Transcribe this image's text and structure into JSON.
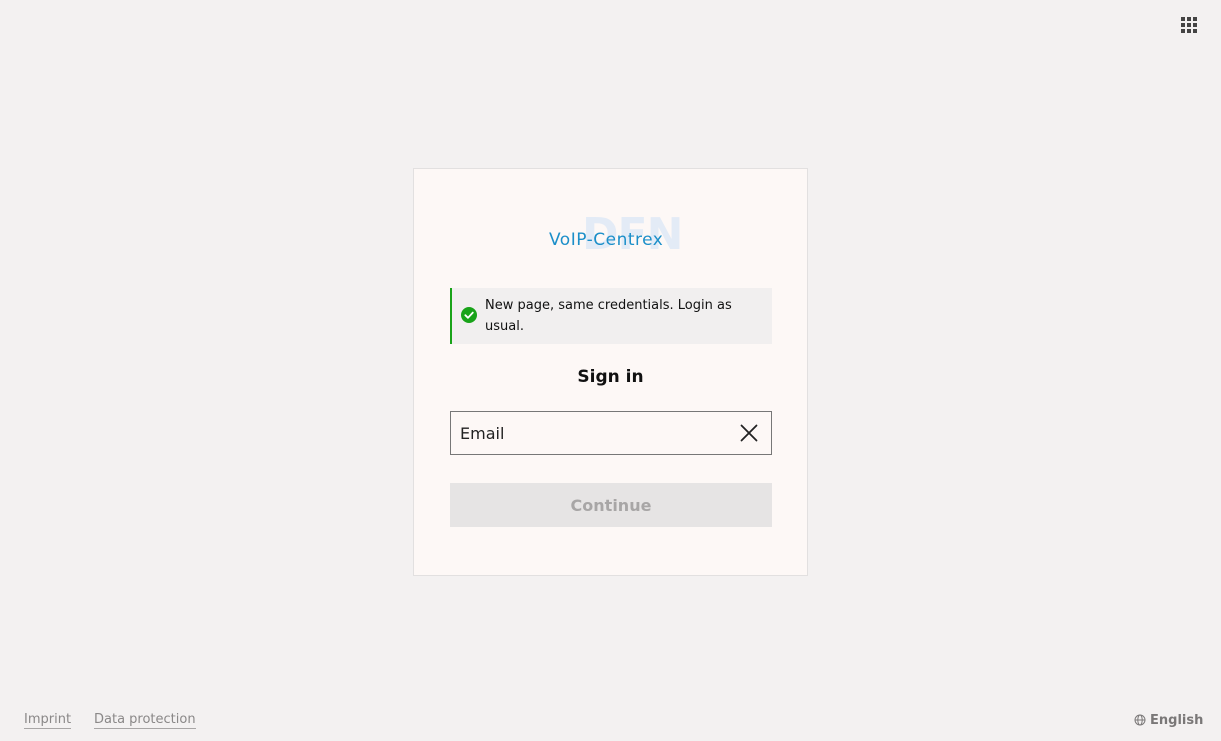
{
  "header": {
    "apps_icon": "apps-grid-icon"
  },
  "logo": {
    "watermark": "DFN",
    "product": "VoIP-Centrex"
  },
  "notice": {
    "icon": "check-circle-icon",
    "text": "New page, same credentials. Login as usual.",
    "accent_color": "#19a319"
  },
  "signin": {
    "title": "Sign in",
    "email_placeholder": "Email",
    "email_value": "",
    "clear_icon": "close-icon",
    "continue_label": "Continue"
  },
  "footer": {
    "imprint": "Imprint",
    "data_protection": "Data protection",
    "language_icon": "globe-icon",
    "language": "English"
  },
  "colors": {
    "brand": "#1c8fc9",
    "background": "#f3f1f1",
    "card": "#fdf8f6"
  }
}
